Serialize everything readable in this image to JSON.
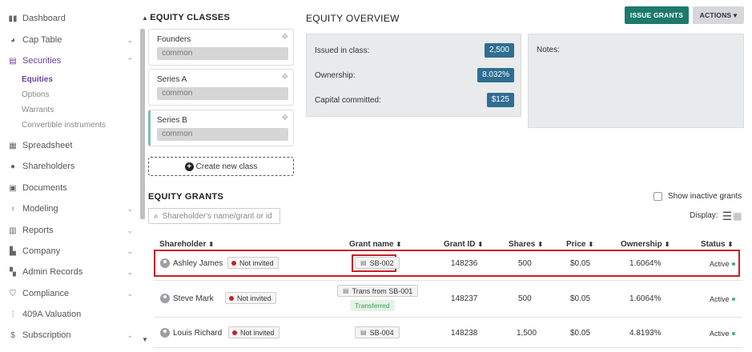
{
  "sidebar": {
    "items": [
      {
        "label": "Dashboard",
        "icon": "dashboard-icon",
        "chevron": ""
      },
      {
        "label": "Cap Table",
        "icon": "pie-chart-icon",
        "chevron": "⌄"
      },
      {
        "label": "Securities",
        "icon": "clipboard-icon",
        "chevron": "⌃"
      },
      {
        "label": "Spreadsheet",
        "icon": "spreadsheet-icon",
        "chevron": ""
      },
      {
        "label": "Shareholders",
        "icon": "user-icon",
        "chevron": ""
      },
      {
        "label": "Documents",
        "icon": "folder-icon",
        "chevron": ""
      },
      {
        "label": "Modeling",
        "icon": "lightbulb-icon",
        "chevron": "⌄"
      },
      {
        "label": "Reports",
        "icon": "report-icon",
        "chevron": "⌄"
      },
      {
        "label": "Company",
        "icon": "building-icon",
        "chevron": "⌄"
      },
      {
        "label": "Admin Records",
        "icon": "records-icon",
        "chevron": "⌄"
      },
      {
        "label": "Compliance",
        "icon": "shield-icon",
        "chevron": "⌄"
      },
      {
        "label": "409A Valuation",
        "icon": "valuation-icon",
        "chevron": ""
      },
      {
        "label": "Subscription",
        "icon": "dollar-icon",
        "chevron": "⌄"
      }
    ],
    "securities_sub": [
      "Equities",
      "Options",
      "Warrants",
      "Convertible instruments"
    ]
  },
  "classes": {
    "title": "EQUITY CLASSES",
    "items": [
      {
        "name": "Founders",
        "type": "common"
      },
      {
        "name": "Series A",
        "type": "common"
      },
      {
        "name": "Series B",
        "type": "common"
      }
    ],
    "create_label": "Create new class"
  },
  "overview": {
    "title": "EQUITY OVERVIEW",
    "rows": [
      {
        "label": "Issued in class:",
        "value": "2,500"
      },
      {
        "label": "Ownership:",
        "value": "8.032%"
      },
      {
        "label": "Capital committed:",
        "value": "$125"
      }
    ],
    "notes_label": "Notes:"
  },
  "buttons": {
    "issue_grants": "ISSUE GRANTS",
    "actions": "ACTIONS"
  },
  "grants": {
    "title": "EQUITY GRANTS",
    "show_inactive": "Show inactive grants",
    "search_placeholder": "Shareholder's name/grant or id",
    "display_label": "Display:",
    "columns": [
      "Shareholder",
      "Grant name",
      "Grant ID",
      "Shares",
      "Price",
      "Ownership",
      "Status"
    ],
    "rows": [
      {
        "shareholder": "Ashley James",
        "invite": "Not invited",
        "grant_name": "SB-002",
        "transferred": "",
        "grant_id": "148236",
        "shares": "500",
        "price": "$0.05",
        "ownership": "1.6064%",
        "status": "Active"
      },
      {
        "shareholder": "Steve Mark",
        "invite": "Not invited",
        "grant_name": "Trans from SB-001",
        "transferred": "Transferred",
        "grant_id": "148237",
        "shares": "500",
        "price": "$0.05",
        "ownership": "1.6064%",
        "status": "Active"
      },
      {
        "shareholder": "Louis Richard",
        "invite": "Not invited",
        "grant_name": "SB-004",
        "transferred": "",
        "grant_id": "148238",
        "shares": "1,500",
        "price": "$0.05",
        "ownership": "4.8193%",
        "status": "Active"
      }
    ]
  },
  "colors": {
    "accent_purple": "#6b3fa0",
    "teal_button": "#1b7a6b",
    "badge_blue": "#2f6e91",
    "highlight_red": "#c62027",
    "active_green": "#3cb371"
  }
}
